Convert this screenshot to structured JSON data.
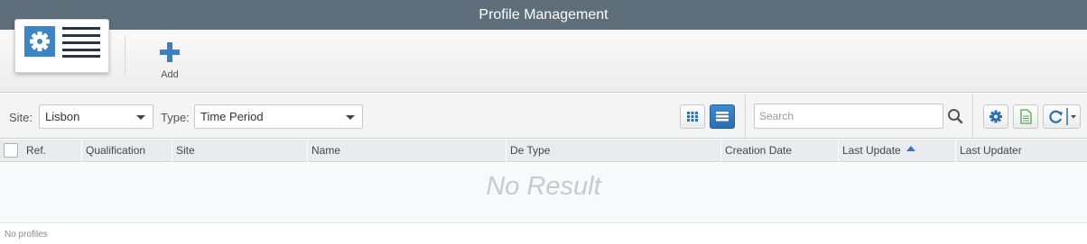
{
  "window": {
    "title": "Profile Management"
  },
  "toolbar": {
    "app_icon": "settings-list-icon",
    "add_label": "Add",
    "add_icon": "plus-icon",
    "accent": "#3d86c6"
  },
  "filters": {
    "site_label": "Site:",
    "site_value": "Lisbon",
    "type_label": "Type:",
    "type_value": "Time Period",
    "view_modes": [
      "grid-view-icon",
      "list-view-icon"
    ],
    "active_view": "list-view-icon",
    "search_placeholder": "Search",
    "search_value": "",
    "tools": [
      "gear-icon",
      "export-document-icon",
      "refresh-icon"
    ]
  },
  "table": {
    "columns": [
      "Ref.",
      "Qualification",
      "Site",
      "Name",
      "De Type",
      "Creation Date",
      "Last Update",
      "Last Updater"
    ],
    "sorted_column": "Last Update",
    "sort_direction": "ascending",
    "rows": [],
    "empty_text": "No Result"
  },
  "footer": {
    "status": "No profiles"
  }
}
